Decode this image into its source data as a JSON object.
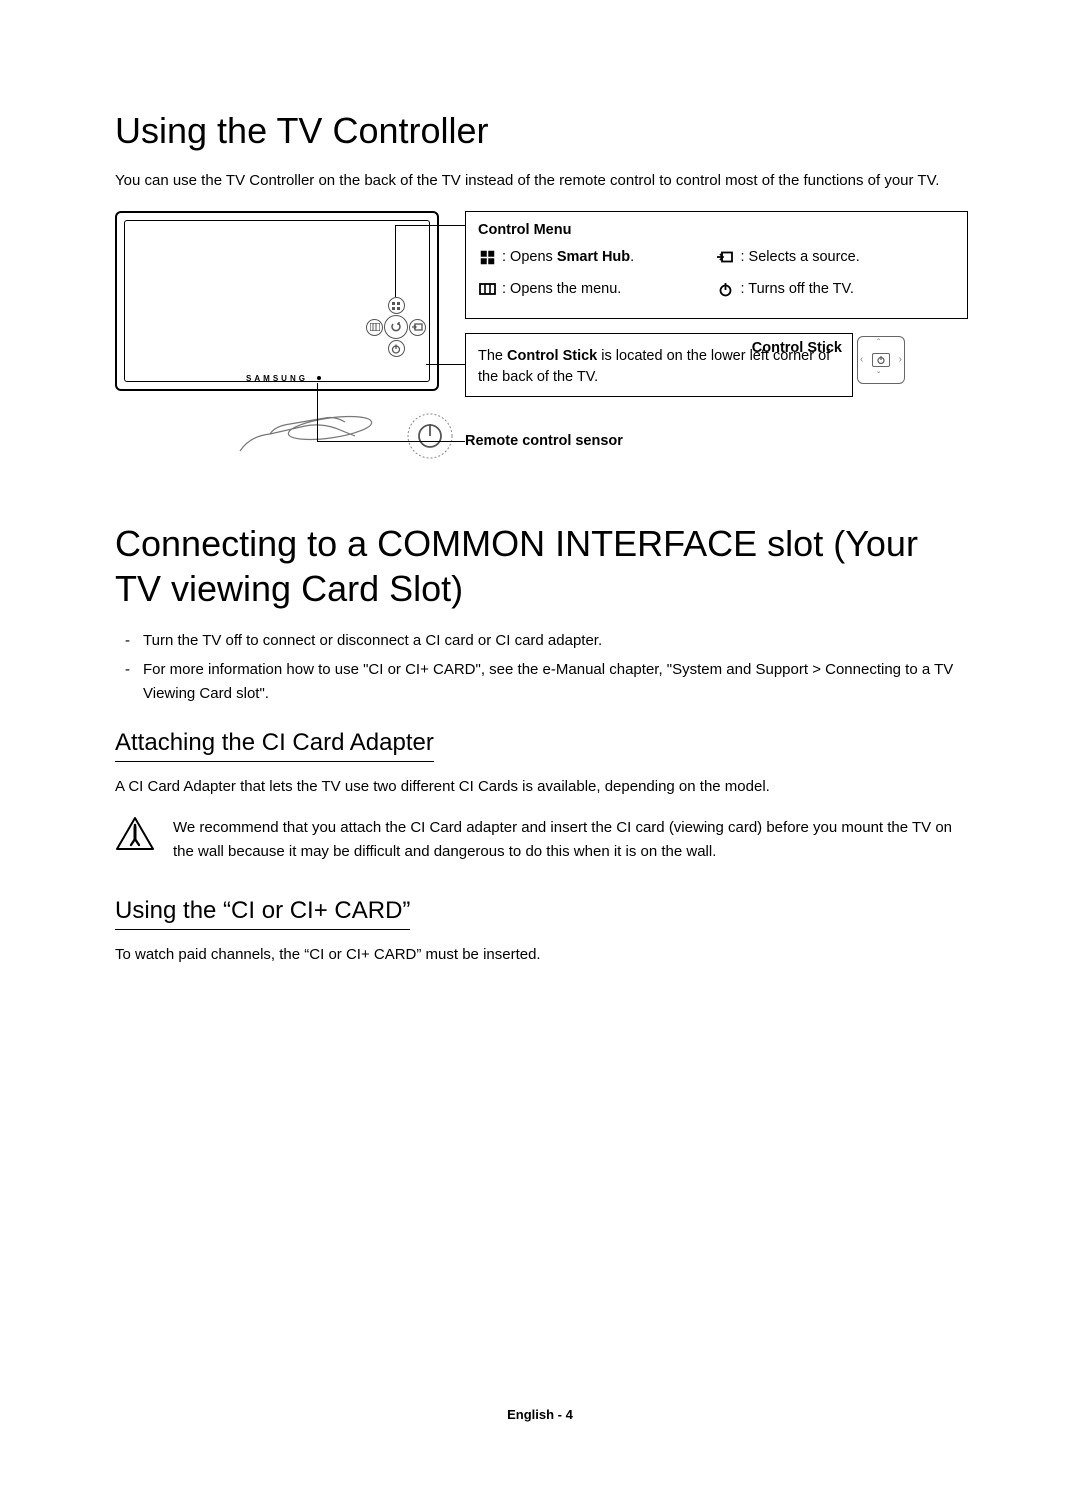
{
  "section1": {
    "heading": "Using the TV Controller",
    "intro": "You can use the TV Controller on the back of the TV instead of the remote control to control most of the functions of your TV.",
    "brand": "SAMSUNG",
    "controlMenu": {
      "title": "Control Menu",
      "items": [
        {
          "pre": ": Opens ",
          "bold": "Smart Hub",
          "post": "."
        },
        {
          "text": ": Selects a source."
        },
        {
          "text": ": Opens the menu."
        },
        {
          "text": ": Turns off the TV."
        }
      ]
    },
    "controlStick": {
      "title": "Control Stick",
      "body_pre": "The ",
      "body_bold": "Control Stick",
      "body_post": " is located on the lower left corner of the back of the TV."
    },
    "sensorLabel": "Remote control sensor"
  },
  "section2": {
    "heading": "Connecting to a COMMON INTERFACE slot (Your TV viewing Card Slot)",
    "bullets": [
      "Turn the TV off to connect or disconnect a CI card or CI card adapter.",
      "For more information how to use \"CI or CI+ CARD\", see the e-Manual chapter, \"System and Support > Connecting to a TV Viewing Card slot\"."
    ],
    "sub1": {
      "heading": "Attaching the CI Card Adapter",
      "para": "A CI Card Adapter that lets the TV use two different CI Cards is available, depending on the model.",
      "note": "We recommend that you attach the CI Card adapter and insert the CI card (viewing card) before you mount the TV on the wall because it may be difficult and dangerous to do this when it is on the wall."
    },
    "sub2": {
      "heading": "Using the “CI or CI+ CARD”",
      "para": "To watch paid channels, the “CI or CI+ CARD” must be inserted."
    }
  },
  "footer": "English - 4"
}
